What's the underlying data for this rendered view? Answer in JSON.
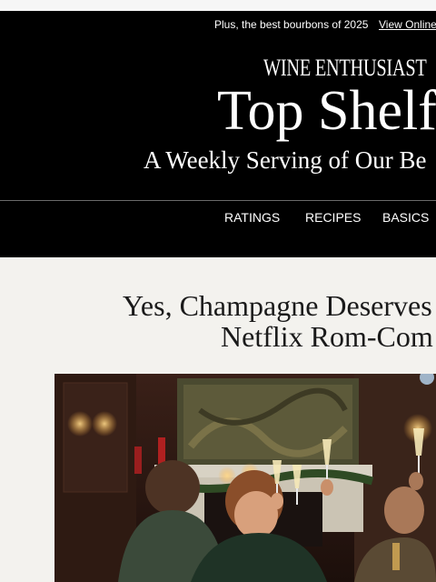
{
  "preheader": {
    "text": "Plus, the best bourbons of 2025",
    "link": "View Online"
  },
  "brand": {
    "logo": "WINE ENTHUSIAST",
    "title": "Top Shelf",
    "tagline": "A Weekly Serving of Our Be"
  },
  "nav": {
    "items": [
      "RATINGS",
      "RECIPES",
      "BASICS"
    ]
  },
  "article": {
    "headline_line1": "Yes, Champagne Deserves",
    "headline_line2": "Netflix Rom-Com"
  },
  "hero_image": {
    "alt_name": "champagne-toast-photo"
  },
  "colors": {
    "header_bg": "#000000",
    "page_bg": "#f3f2ee",
    "headline": "#1a1a1a"
  }
}
